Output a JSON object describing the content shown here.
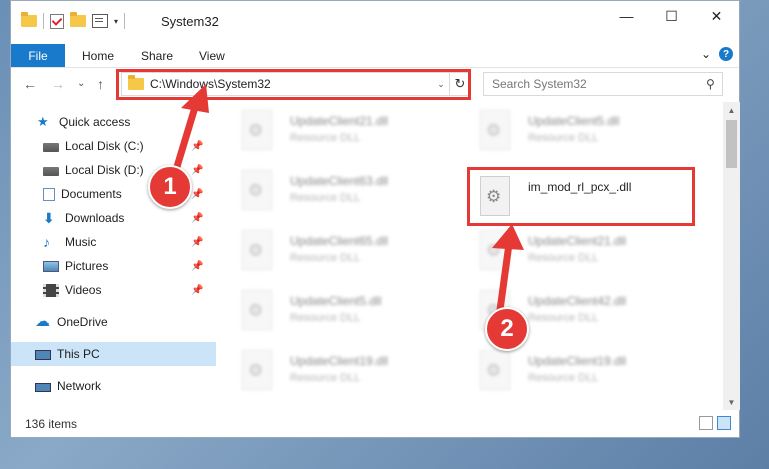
{
  "window": {
    "title": "System32",
    "controls": {
      "minimize": "—",
      "maximize": "☐",
      "close": "✕"
    }
  },
  "ribbon": {
    "file_tab": "File",
    "tabs": [
      "Home",
      "Share",
      "View"
    ],
    "collapse_glyph": "⌄",
    "help_glyph": "?"
  },
  "navigation": {
    "back_glyph": "←",
    "forward_glyph": "→",
    "recent_glyph": "⌄",
    "up_glyph": "↑",
    "address": "C:\\Windows\\System32",
    "address_drop_glyph": "⌄",
    "refresh_glyph": "↻",
    "search_placeholder": "Search System32",
    "search_glyph": "⚲"
  },
  "sidebar": {
    "pin_glyph": "📌",
    "items": [
      {
        "label": "Quick access",
        "icon": "star-icon",
        "pinned": false
      },
      {
        "label": "Local Disk (C:)",
        "icon": "drive-icon",
        "pinned": true
      },
      {
        "label": "Local Disk (D:)",
        "icon": "drive-icon",
        "pinned": true
      },
      {
        "label": "Documents",
        "icon": "documents-icon",
        "pinned": true
      },
      {
        "label": "Downloads",
        "icon": "download-icon",
        "pinned": true
      },
      {
        "label": "Music",
        "icon": "music-icon",
        "pinned": true
      },
      {
        "label": "Pictures",
        "icon": "pictures-icon",
        "pinned": true
      },
      {
        "label": "Videos",
        "icon": "videos-icon",
        "pinned": true
      },
      {
        "label": "OneDrive",
        "icon": "cloud-icon",
        "pinned": false
      },
      {
        "label": "This PC",
        "icon": "pc-icon",
        "pinned": false,
        "selected": true
      },
      {
        "label": "Network",
        "icon": "network-icon",
        "pinned": false
      }
    ]
  },
  "files": {
    "left": [
      {
        "name": "UpdateClient21.dll",
        "type": "Resource DLL"
      },
      {
        "name": "UpdateClient63.dll",
        "type": "Resource DLL"
      },
      {
        "name": "UpdateClient65.dll",
        "type": "Resource DLL"
      },
      {
        "name": "UpdateClient5.dll",
        "type": "Resource DLL"
      },
      {
        "name": "UpdateClient19.dll",
        "type": "Resource DLL"
      }
    ],
    "right": [
      {
        "name": "UpdateClient5.dll",
        "type": "Resource DLL"
      },
      {
        "name": "im_mod_rl_pcx_.dll",
        "type": ""
      },
      {
        "name": "UpdateClient21.dll",
        "type": "Resource DLL"
      },
      {
        "name": "UpdateClient42.dll",
        "type": "Resource DLL"
      },
      {
        "name": "UpdateClient19.dll",
        "type": "Resource DLL"
      }
    ]
  },
  "status": {
    "item_count": "136 items"
  },
  "annotations": {
    "step1": "1",
    "step2": "2",
    "color": "#e53935"
  }
}
